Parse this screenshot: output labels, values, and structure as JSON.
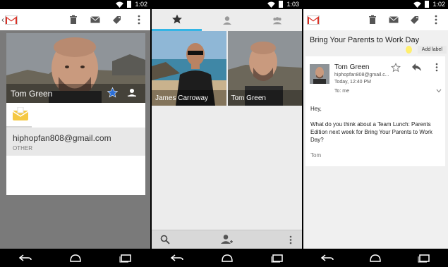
{
  "status_bar": [
    {
      "time": "1:02"
    },
    {
      "time": "1:03"
    },
    {
      "time": "1:02"
    }
  ],
  "contact": {
    "name": "Tom Green",
    "email": "hiphopfan808@gmail.com",
    "email_type": "OTHER",
    "starred": true,
    "star_color": "#2c6fd6"
  },
  "people_tabs": [
    "star-icon",
    "person-icon",
    "group-icon"
  ],
  "people": [
    {
      "name": "James Carroway"
    },
    {
      "name": "Tom Green"
    }
  ],
  "message": {
    "subject": "Bring Your Parents to Work Day",
    "add_label": "Add label",
    "sender_name": "Tom Green",
    "sender_email": "hiphopfan808@gmail.c...",
    "date": "Today, 12:40 PM",
    "to": "To: me",
    "greeting": "Hey,",
    "body": "What do you think about a Team Lunch: Parents Edition next week for Bring Your Parents to Work Day?",
    "signature": "Tom"
  },
  "colors": {
    "accent": "#33b5e5",
    "gmail_red": "#d93025",
    "label_yellow": "#ffef6e"
  }
}
